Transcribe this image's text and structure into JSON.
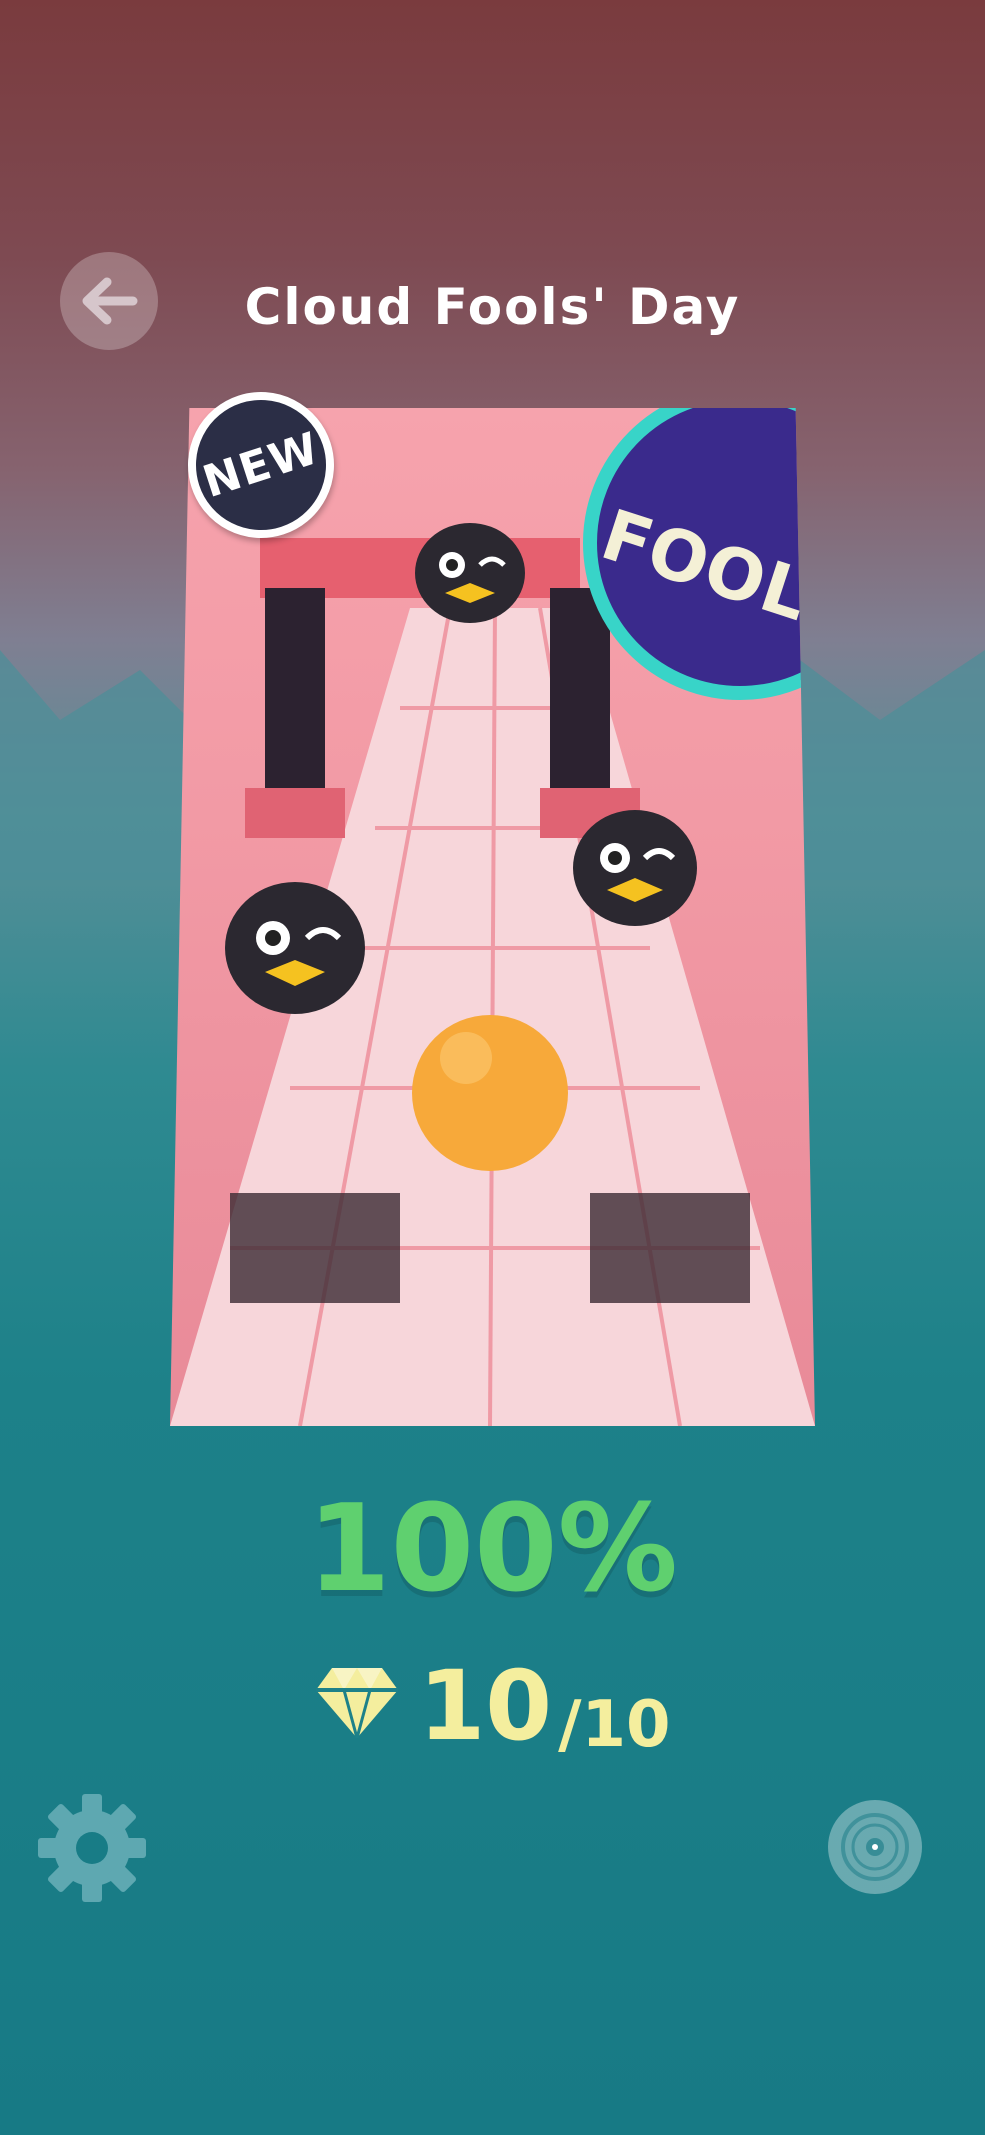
{
  "header": {
    "title": "Cloud Fools' Day",
    "back_icon": "arrow-left-icon"
  },
  "level_card": {
    "badge": "NEW",
    "logo_text": "FOOL",
    "colors": {
      "tile_pink": "#f6a3ad",
      "ball": "#f7a93a"
    }
  },
  "progress": {
    "percent_text": "100%",
    "value": 1.0
  },
  "gems": {
    "icon": "diamond-icon",
    "collected": "10",
    "separator": "/",
    "total": "10"
  },
  "footer": {
    "settings_icon": "gear-icon",
    "music_icon": "disc-icon"
  },
  "colors": {
    "percent": "#5fd06f",
    "gems": "#f4ee9e",
    "bg_top": "#7a3b3e",
    "bg_bottom": "#177a85"
  }
}
